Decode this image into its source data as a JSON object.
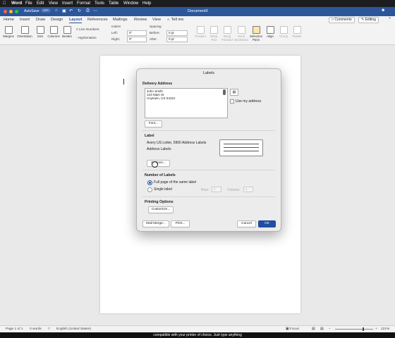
{
  "mac_menu": {
    "app": "Word",
    "items": [
      "File",
      "Edit",
      "View",
      "Insert",
      "Format",
      "Tools",
      "Table",
      "Window",
      "Help"
    ]
  },
  "titlebar": {
    "autosave": "AutoSave",
    "doc_title": "Document3",
    "toggle": "OFF"
  },
  "tabs": [
    "Home",
    "Insert",
    "Draw",
    "Design",
    "Layout",
    "References",
    "Mailings",
    "Review",
    "View",
    "Tell me"
  ],
  "active_tab": "Layout",
  "comments_label": "Comments",
  "editing_label": "Editing",
  "ribbon": {
    "margins": "Margins",
    "orientation": "Orientation",
    "size": "Size",
    "columns": "Columns",
    "breaks": "Breaks",
    "line_numbers": "Line Numbers",
    "hyphenation": "Hyphenation",
    "indent": "Indent",
    "left": "Left:",
    "right": "Right:",
    "left_val": "0\"",
    "right_val": "0\"",
    "spacing": "Spacing",
    "before": "Before:",
    "after": "After:",
    "before_val": "0 pt",
    "after_val": "0 pt",
    "position": "Position",
    "wrap_text": "Wrap Text",
    "bring_forward": "Bring Forward",
    "send_backward": "Send Backward",
    "selection_pane": "Selection Pane",
    "align": "Align",
    "group": "Group",
    "rotate": "Rotate"
  },
  "dialog": {
    "title": "Labels",
    "delivery_address_heading": "Delivery Address",
    "address_lines": [
      "John Smith",
      "123 Main St",
      "Anytown, US 54321"
    ],
    "use_my_address": "Use my address",
    "font_button": "Font...",
    "label_heading": "Label",
    "label_name": "Avery US Letter, 5960 Address Labels",
    "label_type": "Address Labels",
    "options_button": "Options...",
    "number_heading": "Number of Labels",
    "full_page": "Full page of the same label",
    "single_label": "Single label",
    "row_label": "Row:",
    "column_label": "Column:",
    "row_value": "1",
    "column_value": "1",
    "printing_heading": "Printing Options",
    "customize_button": "Customize...",
    "mail_merge_button": "Mail Merge...",
    "print_button": "Print...",
    "cancel_button": "Cancel",
    "ok_button": "OK"
  },
  "status": {
    "page": "Page 1 of 1",
    "words": "0 words",
    "language": "English (United States)",
    "focus": "Focus",
    "zoom": "121%"
  },
  "caption": "compatible with your printer of choice. Just type anything",
  "colors": {
    "accent": "#2b579a",
    "primary_button": "#1f4fa0"
  }
}
